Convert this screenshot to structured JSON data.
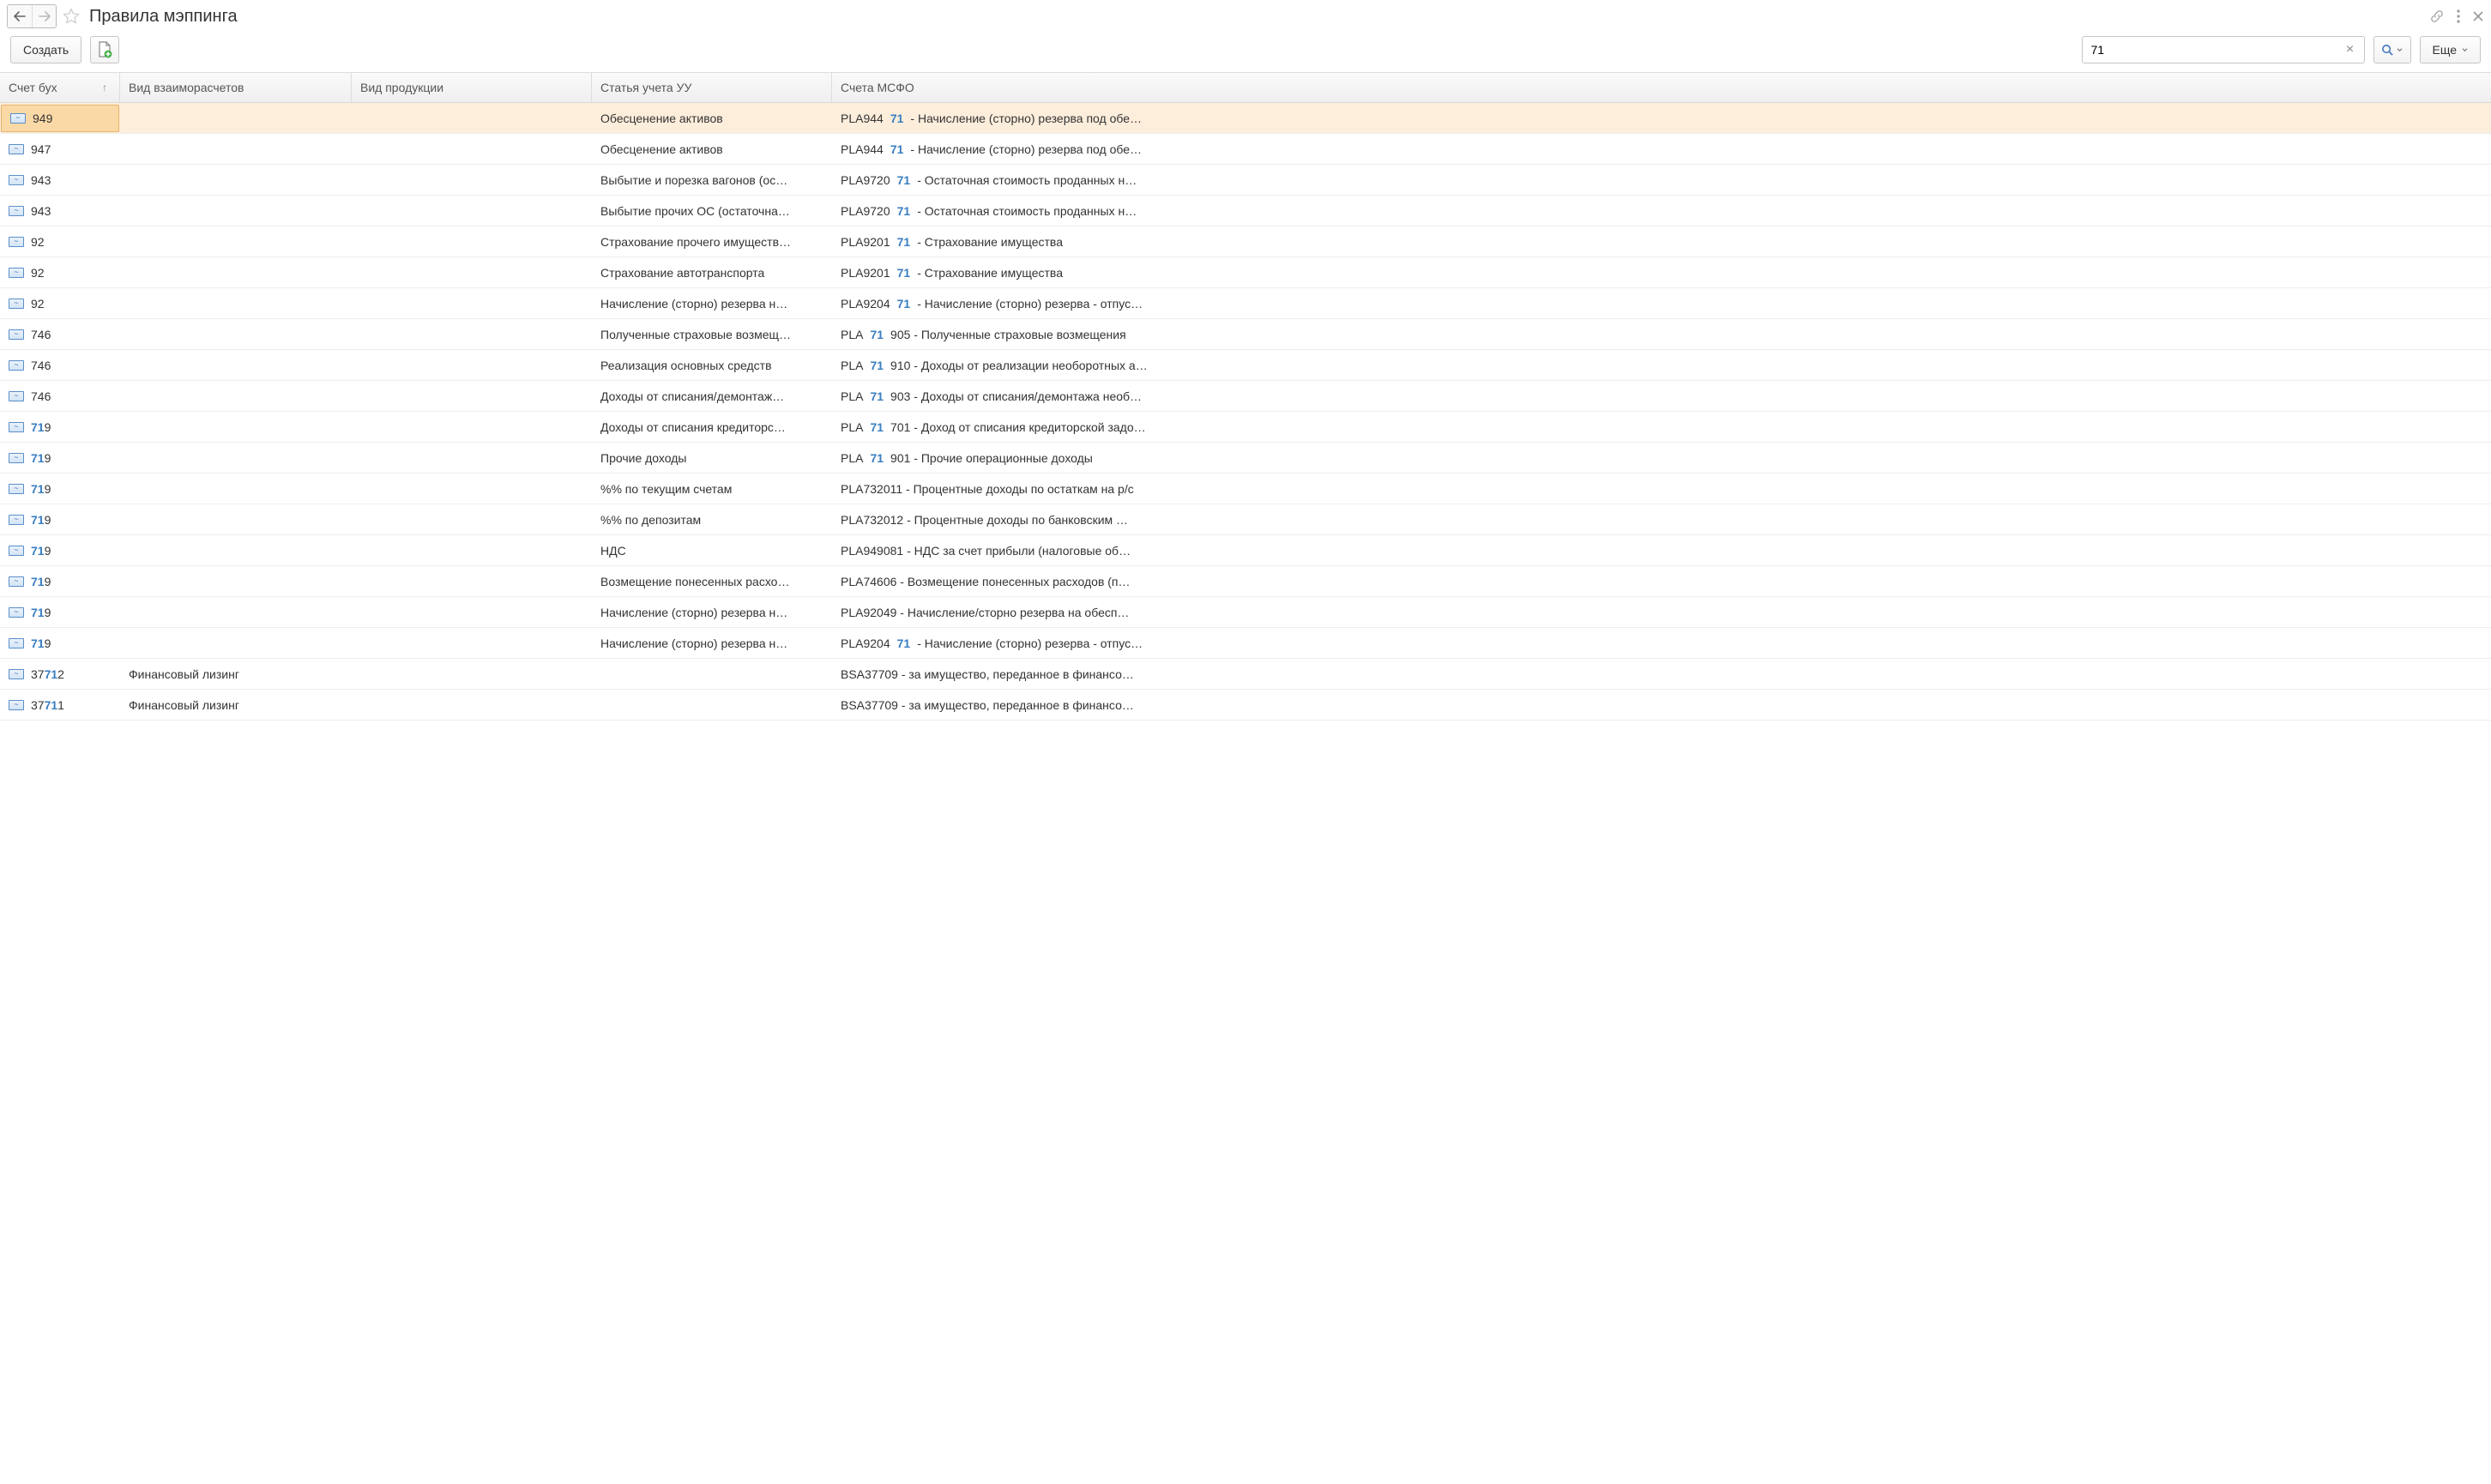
{
  "header": {
    "title": "Правила мэппинга"
  },
  "toolbar": {
    "create_label": "Создать",
    "more_label": "Еще"
  },
  "search": {
    "value": "71"
  },
  "table": {
    "columns": {
      "c1": "Счет бух",
      "c2": "Вид взаиморасчетов",
      "c3": "Вид продукции",
      "c4": "Статья учета УУ",
      "c5": "Счета МСФО"
    },
    "rows": [
      {
        "acct": "949",
        "acct_hl": "",
        "settle": "",
        "prod": "",
        "article": "Обесценение активов",
        "msfo_pre": "PLA944",
        "msfo_hl": "71",
        "msfo_post": " - Начисление (сторно) резерва под обе…",
        "selected": true
      },
      {
        "acct": "947",
        "acct_hl": "",
        "settle": "",
        "prod": "",
        "article": "Обесценение активов",
        "msfo_pre": "PLA944",
        "msfo_hl": "71",
        "msfo_post": " - Начисление (сторно) резерва под обе…"
      },
      {
        "acct": "943",
        "acct_hl": "",
        "settle": "",
        "prod": "",
        "article": "Выбытие и порезка вагонов (ос…",
        "msfo_pre": "PLA9720",
        "msfo_hl": "71",
        "msfo_post": " - Остаточная стоимость проданных н…"
      },
      {
        "acct": "943",
        "acct_hl": "",
        "settle": "",
        "prod": "",
        "article": "Выбытие прочих ОС (остаточна…",
        "msfo_pre": "PLA9720",
        "msfo_hl": "71",
        "msfo_post": " - Остаточная стоимость проданных н…"
      },
      {
        "acct": "92",
        "acct_hl": "",
        "settle": "",
        "prod": "",
        "article": "Страхование прочего имуществ…",
        "msfo_pre": "PLA9201",
        "msfo_hl": "71",
        "msfo_post": " - Страхование имущества"
      },
      {
        "acct": "92",
        "acct_hl": "",
        "settle": "",
        "prod": "",
        "article": "Страхование автотранспорта",
        "msfo_pre": "PLA9201",
        "msfo_hl": "71",
        "msfo_post": " - Страхование имущества"
      },
      {
        "acct": "92",
        "acct_hl": "",
        "settle": "",
        "prod": "",
        "article": "Начисление (сторно) резерва н…",
        "msfo_pre": "PLA9204",
        "msfo_hl": "71",
        "msfo_post": " - Начисление (сторно) резерва - отпус…"
      },
      {
        "acct": "746",
        "acct_hl": "",
        "settle": "",
        "prod": "",
        "article": "Полученные страховые возмещ…",
        "msfo_pre": "PLA",
        "msfo_hl": "71",
        "msfo_post": "905 - Полученные страховые возмещения"
      },
      {
        "acct": "746",
        "acct_hl": "",
        "settle": "",
        "prod": "",
        "article": "Реализация основных средств",
        "msfo_pre": "PLA",
        "msfo_hl": "71",
        "msfo_post": "910 - Доходы от реализации необоротных а…"
      },
      {
        "acct": "746",
        "acct_hl": "",
        "settle": "",
        "prod": "",
        "article": "Доходы от списания/демонтаж…",
        "msfo_pre": "PLA",
        "msfo_hl": "71",
        "msfo_post": "903 - Доходы от списания/демонтажа необ…"
      },
      {
        "acct_pre": "",
        "acct_hl": "71",
        "acct_post": "9",
        "settle": "",
        "prod": "",
        "article": "Доходы от списания кредиторс…",
        "msfo_pre": "PLA",
        "msfo_hl": "71",
        "msfo_post": "701 - Доход от списания кредиторской задо…"
      },
      {
        "acct_pre": "",
        "acct_hl": "71",
        "acct_post": "9",
        "settle": "",
        "prod": "",
        "article": "Прочие доходы",
        "msfo_pre": "PLA",
        "msfo_hl": "71",
        "msfo_post": "901 - Прочие операционные доходы"
      },
      {
        "acct_pre": "",
        "acct_hl": "71",
        "acct_post": "9",
        "settle": "",
        "prod": "",
        "article": "%% по текущим счетам",
        "msfo_pre": "PLA732011 - Процентные доходы по остаткам на р/с",
        "msfo_hl": "",
        "msfo_post": ""
      },
      {
        "acct_pre": "",
        "acct_hl": "71",
        "acct_post": "9",
        "settle": "",
        "prod": "",
        "article": "%% по депозитам",
        "msfo_pre": "PLA732012 - Процентные доходы по банковским …",
        "msfo_hl": "",
        "msfo_post": ""
      },
      {
        "acct_pre": "",
        "acct_hl": "71",
        "acct_post": "9",
        "settle": "",
        "prod": "",
        "article": "НДС",
        "msfo_pre": "PLA949081 - НДС за счет прибыли (налоговые об…",
        "msfo_hl": "",
        "msfo_post": ""
      },
      {
        "acct_pre": "",
        "acct_hl": "71",
        "acct_post": "9",
        "settle": "",
        "prod": "",
        "article": "Возмещение понесенных расхо…",
        "msfo_pre": "PLA74606 - Возмещение понесенных расходов (п…",
        "msfo_hl": "",
        "msfo_post": ""
      },
      {
        "acct_pre": "",
        "acct_hl": "71",
        "acct_post": "9",
        "settle": "",
        "prod": "",
        "article": "Начисление (сторно) резерва н…",
        "msfo_pre": "PLA92049 - Начисление/сторно резерва на обесп…",
        "msfo_hl": "",
        "msfo_post": ""
      },
      {
        "acct_pre": "",
        "acct_hl": "71",
        "acct_post": "9",
        "settle": "",
        "prod": "",
        "article": "Начисление (сторно) резерва н…",
        "msfo_pre": "PLA9204",
        "msfo_hl": "71",
        "msfo_post": " - Начисление (сторно) резерва - отпус…"
      },
      {
        "acct_pre": "37",
        "acct_hl": "71",
        "acct_post": "2",
        "settle": "Финансовый лизинг",
        "prod": "",
        "article": "",
        "msfo_pre": "BSA37709 - за имущество, переданное в финансо…",
        "msfo_hl": "",
        "msfo_post": ""
      },
      {
        "acct_pre": "37",
        "acct_hl": "71",
        "acct_post": "1",
        "settle": "Финансовый лизинг",
        "prod": "",
        "article": "",
        "msfo_pre": "BSA37709 - за имущество, переданное в финансо…",
        "msfo_hl": "",
        "msfo_post": ""
      }
    ]
  }
}
